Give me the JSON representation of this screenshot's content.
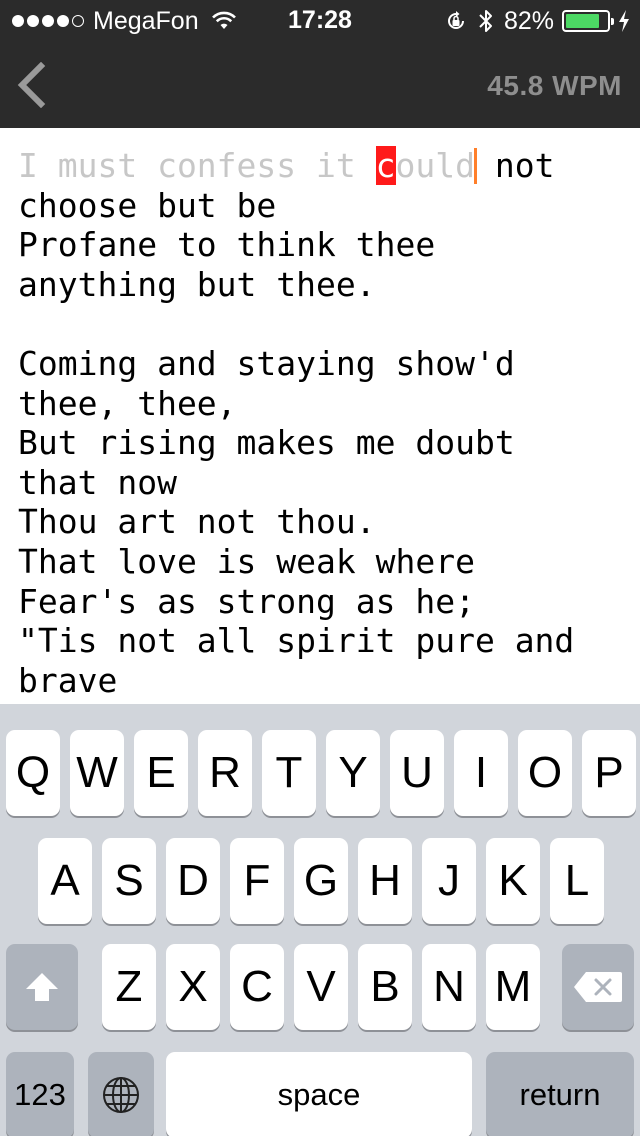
{
  "status_bar": {
    "carrier": "MegaFon",
    "time": "17:28",
    "battery_percent": "82%",
    "battery_level": 0.82,
    "signal_bars": 4,
    "signal_max": 5,
    "icons": [
      "wifi-icon",
      "rotation-lock-icon",
      "bluetooth-icon",
      "battery-icon",
      "charging-bolt-icon"
    ]
  },
  "nav": {
    "back_icon": "chevron-left-icon",
    "wpm": "45.8 WPM"
  },
  "text": {
    "typed": "I must confess it ",
    "current_char": "c",
    "typed_after_char": "ould",
    "remaining": " not\nchoose but be\nProfane to think thee\nanything but thee.\n\nComing and staying show'd\nthee, thee,\nBut rising makes me doubt\nthat now\nThou art not thou.\nThat love is weak where\nFear's as strong as he;\n\"Tis not all spirit pure and\nbrave"
  },
  "keyboard": {
    "row1": [
      "Q",
      "W",
      "E",
      "R",
      "T",
      "Y",
      "U",
      "I",
      "O",
      "P"
    ],
    "row2": [
      "A",
      "S",
      "D",
      "F",
      "G",
      "H",
      "J",
      "K",
      "L"
    ],
    "row3": [
      "Z",
      "X",
      "C",
      "V",
      "B",
      "N",
      "M"
    ],
    "numbers_label": "123",
    "space_label": "space",
    "return_label": "return",
    "shift_icon": "shift-icon",
    "globe_icon": "globe-icon",
    "delete_icon": "backspace-icon"
  },
  "colors": {
    "header_bg": "#2b2b2b",
    "typed_text": "#c7c7c7",
    "highlight": "#ff1a1a",
    "caret": "#ff7f2a",
    "battery_green": "#4cd964",
    "keyboard_bg": "#d1d5db"
  }
}
